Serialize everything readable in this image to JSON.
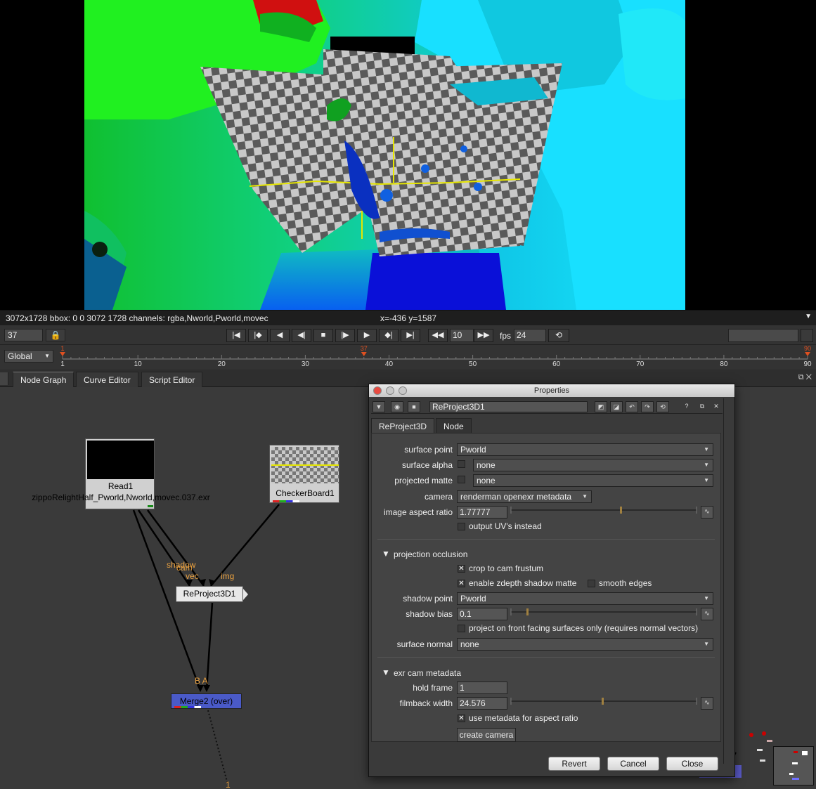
{
  "viewer": {
    "info": "3072x1728 bbox: 0 0 3072 1728 channels: rgba,Nworld,Pworld,movec",
    "coords": "x=-436 y=1587",
    "menu_icon": "dropdown-arrow"
  },
  "playback": {
    "current_frame": "37",
    "increment": "10",
    "fps_label": "fps",
    "fps": "24",
    "buttons": [
      "first-frame",
      "prev-keyframe",
      "play-back",
      "prev-frame",
      "stop",
      "next-frame",
      "play-forward",
      "next-keyframe",
      "last-frame",
      "skip-back",
      "skip-forward"
    ]
  },
  "timeline": {
    "scope": "Global",
    "ticks": [
      "1",
      "10",
      "20",
      "30",
      "40",
      "50",
      "60",
      "70",
      "80",
      "90"
    ],
    "in_marker": "1",
    "out_marker": "90",
    "current_marker": "37",
    "current_frame": 37,
    "start": 1,
    "end": 90
  },
  "tabs": [
    "Node Graph",
    "Curve Editor",
    "Script Editor"
  ],
  "nodes": {
    "read_name": "Read1",
    "read_file": "zippoRelightHalf_Pworld,Nworld,movec.037.exr",
    "checker_name": "CheckerBoard1",
    "reproject_name": "ReProject3D1",
    "merge_name": "Merge2 (over)",
    "labels": {
      "shadow": "shadow",
      "cam": "cam",
      "vec": "vec",
      "img": "img",
      "ba": "B A",
      "out_num": "1"
    }
  },
  "properties": {
    "title": "Properties",
    "node_name": "ReProject3D1",
    "tabs": [
      "ReProject3D",
      "Node"
    ],
    "fields": {
      "surface_point_label": "surface point",
      "surface_point": "Pworld",
      "surface_alpha_label": "surface alpha",
      "surface_alpha": "none",
      "projected_matte_label": "projected matte",
      "projected_matte": "none",
      "camera_label": "camera",
      "camera": "renderman openexr metadata",
      "aspect_label": "image aspect ratio",
      "aspect": "1.77777",
      "output_uv": "output UV's instead",
      "occlusion_section": "projection occlusion",
      "crop_frustum": "crop to cam frustum",
      "zdepth_matte": "enable zdepth shadow matte",
      "smooth_edges": "smooth edges",
      "shadow_point_label": "shadow point",
      "shadow_point": "Pworld",
      "shadow_bias_label": "shadow bias",
      "shadow_bias": "0.1",
      "front_facing": "project on front facing surfaces only (requires normal vectors)",
      "surface_normal_label": "surface normal",
      "surface_normal": "none",
      "exr_section": "exr cam metadata",
      "hold_frame_label": "hold frame",
      "hold_frame": "1",
      "filmback_label": "filmback width",
      "filmback": "24.576",
      "use_metadata": "use metadata for aspect ratio",
      "create_camera": "create camera"
    },
    "buttons": {
      "revert": "Revert",
      "cancel": "Cancel",
      "close": "Close"
    },
    "header_icons": [
      "collapse-arrow-icon",
      "view-node-icon",
      "camera-icon",
      "link-icon",
      "link2-icon",
      "undo-icon",
      "redo-icon",
      "revert-icon",
      "help-icon",
      "float-icon",
      "close-icon"
    ]
  },
  "colors": {
    "merge_node": "#4a5ac8",
    "label_orange": "#e8a040",
    "timeline_marker": "#e05020"
  }
}
